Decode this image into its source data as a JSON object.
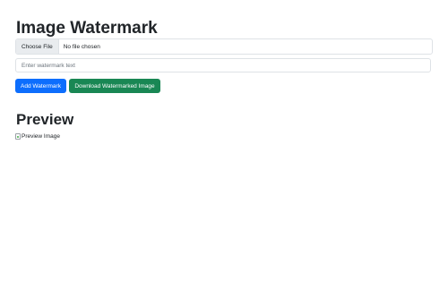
{
  "page": {
    "title": "Image Watermark",
    "preview_heading": "Preview"
  },
  "file_input": {
    "button_label": "Choose File",
    "status": "No file chosen"
  },
  "watermark_input": {
    "placeholder": "Enter watermark text",
    "value": ""
  },
  "buttons": {
    "add_label": "Add Watermark",
    "download_label": "Download Watermarked Image"
  },
  "preview": {
    "alt_text": "Preview Image",
    "icon": "broken-image-icon"
  },
  "colors": {
    "primary": "#0d6efd",
    "success": "#198754",
    "text": "#212529",
    "border": "#dee2e6",
    "file_button_bg": "#e9ecef"
  }
}
